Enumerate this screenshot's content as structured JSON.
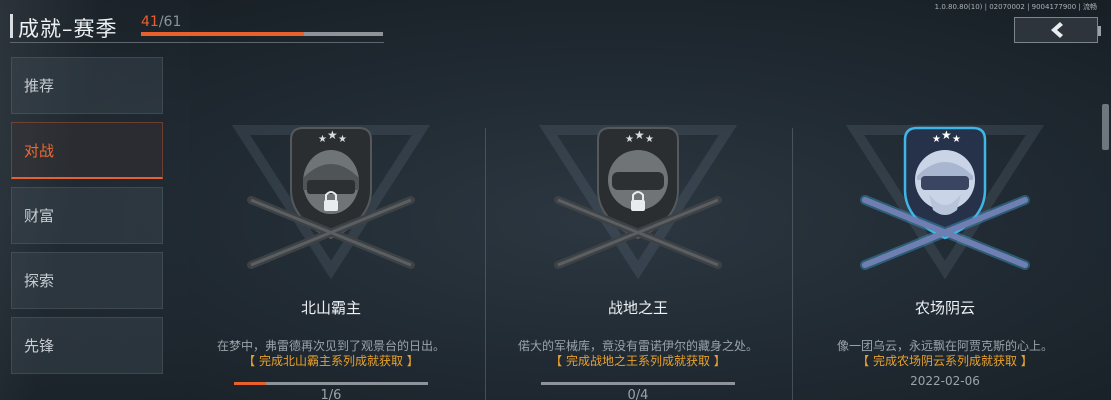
{
  "version": "1.0.80.80(10) | 02070002 | 9004177900 | 流畅",
  "header": {
    "title": "成就–赛季",
    "progress_current": "41",
    "progress_separator": "/",
    "progress_total": "61",
    "progress_fraction": 0.672
  },
  "back_icon": "chevron-left-icon",
  "sidebar": {
    "items": [
      {
        "label": "推荐",
        "active": false
      },
      {
        "label": "对战",
        "active": true
      },
      {
        "label": "财富",
        "active": false
      },
      {
        "label": "探索",
        "active": false
      },
      {
        "label": "先锋",
        "active": false
      }
    ]
  },
  "colors": {
    "accent": "#e8602c",
    "requirement": "#e8a12c",
    "locked_emblem": "#4a4f53",
    "unlocked_emblem": "#8aa6c8",
    "unlocked_glow": "#3fb6e8"
  },
  "cards": [
    {
      "name": "北山霸主",
      "desc": "在梦中，弗雷德再次见到了观景台的日出。",
      "requirement": "【 完成北山霸主系列成就获取 】",
      "progress": "1/6",
      "progress_fraction": 0.167,
      "locked": true,
      "date": ""
    },
    {
      "name": "战地之王",
      "desc": "偌大的军械库，竟没有雷诺伊尔的藏身之处。",
      "requirement": "【 完成战地之王系列成就获取 】",
      "progress": "0/4",
      "progress_fraction": 0.0,
      "locked": true,
      "date": ""
    },
    {
      "name": "农场阴云",
      "desc": "像一团乌云，永远飘在阿贾克斯的心上。",
      "requirement": "【 完成农场阴云系列成就获取 】",
      "progress": "",
      "progress_fraction": 1.0,
      "locked": false,
      "date": "2022-02-06"
    }
  ]
}
